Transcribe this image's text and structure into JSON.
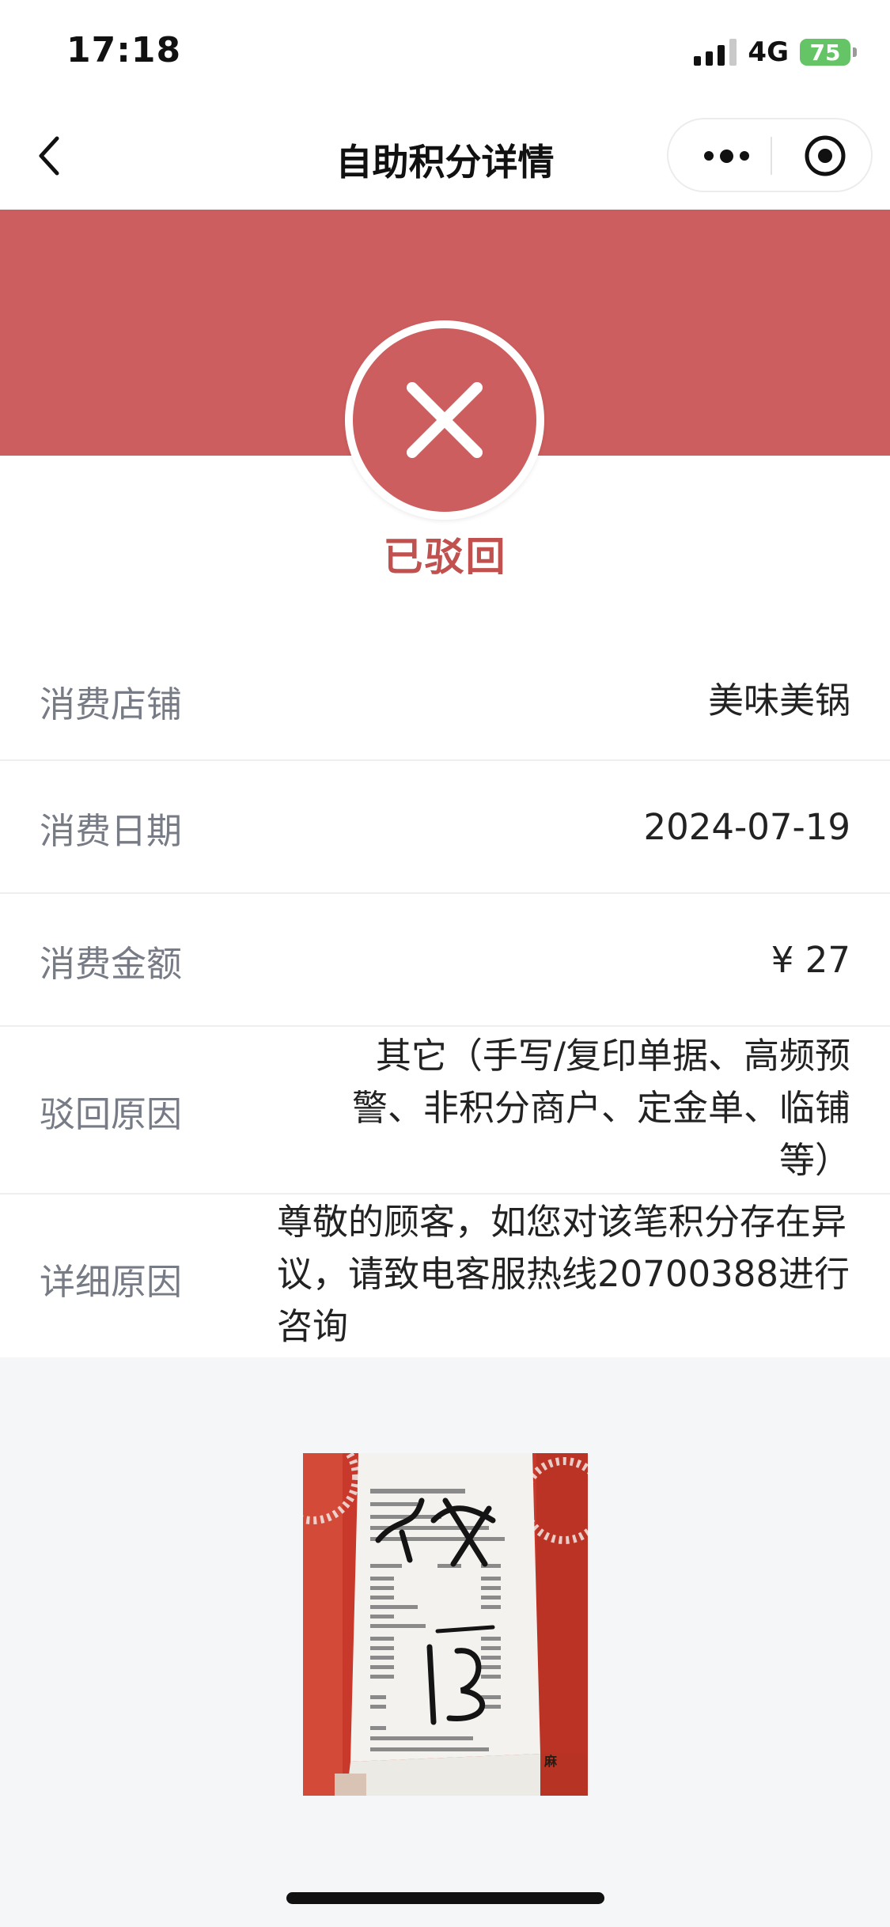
{
  "status_bar": {
    "time": "17:18",
    "network": "4G",
    "battery": "75"
  },
  "nav": {
    "title": "自助积分详情"
  },
  "status": {
    "label": "已驳回"
  },
  "rows": [
    {
      "label": "消费店铺",
      "value": "美味美锅"
    },
    {
      "label": "消费日期",
      "value": "2024-07-19"
    },
    {
      "label": "消费金额",
      "value": "¥ 27"
    },
    {
      "label": "驳回原因",
      "value": "其它（手写/复印单据、高频预警、非积分商户、定金单、临铺等）"
    },
    {
      "label": "详细原因",
      "value": "尊敬的顾客，如您对该笔积分存在异议，请致电客服热线20700388进行咨询"
    }
  ],
  "receipt": {
    "handwriting": "15"
  },
  "colors": {
    "accent_red": "#cd5e5f",
    "status_text": "#c0514f",
    "label_gray": "#777b85"
  }
}
